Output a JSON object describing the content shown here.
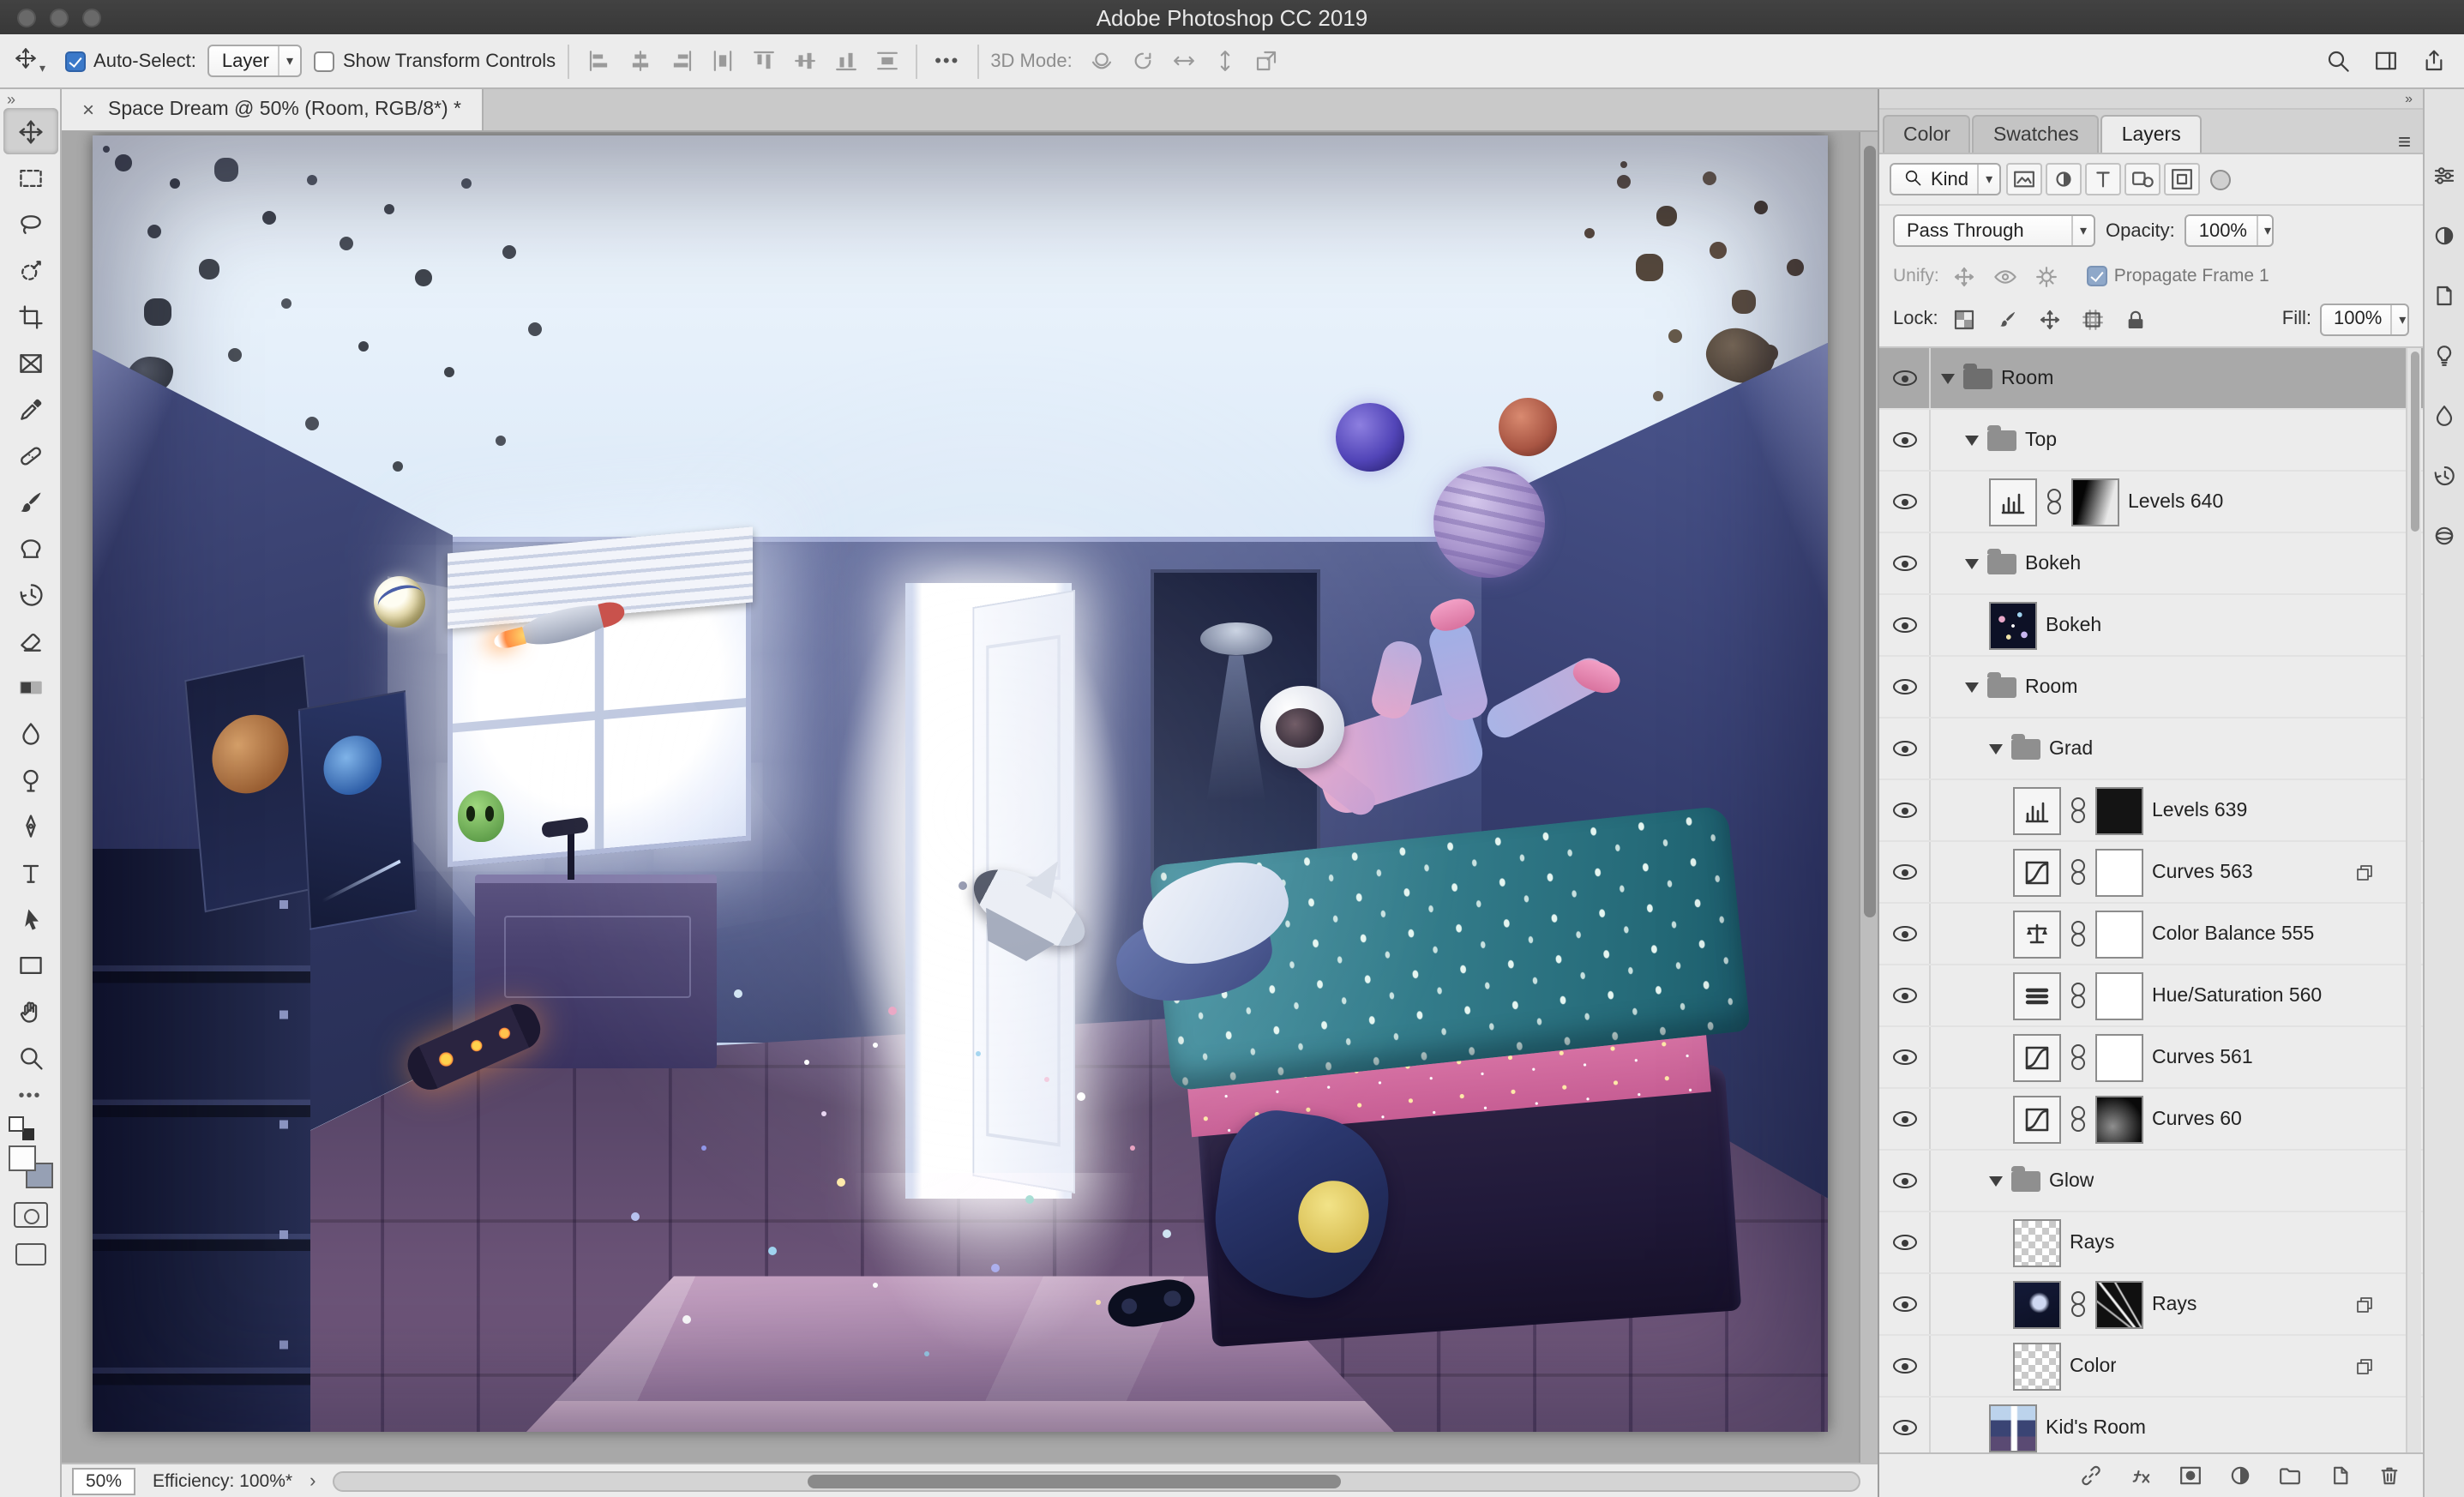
{
  "window": {
    "title": "Adobe Photoshop CC 2019"
  },
  "options_bar": {
    "auto_select": {
      "label": "Auto-Select:",
      "value": "Layer",
      "checked": true
    },
    "show_transform": {
      "label": "Show Transform Controls",
      "checked": false
    },
    "ellipsis": "•••",
    "mode_3d": {
      "label": "3D Mode:"
    },
    "align_icons": [
      "align-left-edges-icon",
      "align-horizontal-centers-icon",
      "align-right-edges-icon",
      "distribute-horizontal-icon",
      "align-top-edges-icon",
      "align-vertical-centers-icon",
      "align-bottom-edges-icon",
      "distribute-vertical-icon"
    ],
    "mode_3d_icons": [
      "3d-orbit-icon",
      "3d-roll-icon",
      "3d-pan-icon",
      "3d-slide-icon",
      "3d-scale-icon"
    ],
    "right_icons": [
      "search-icon",
      "workspace-icon",
      "share-icon"
    ]
  },
  "toolbar": {
    "tools": [
      {
        "id": "move-tool",
        "selected": true
      },
      {
        "id": "marquee-tool"
      },
      {
        "id": "lasso-tool"
      },
      {
        "id": "quick-select-tool"
      },
      {
        "id": "crop-tool"
      },
      {
        "id": "frame-tool"
      },
      {
        "id": "eyedropper-tool"
      },
      {
        "id": "healing-brush-tool"
      },
      {
        "id": "brush-tool"
      },
      {
        "id": "clone-stamp-tool"
      },
      {
        "id": "history-brush-tool"
      },
      {
        "id": "eraser-tool"
      },
      {
        "id": "gradient-tool"
      },
      {
        "id": "blur-tool"
      },
      {
        "id": "dodge-tool"
      },
      {
        "id": "pen-tool"
      },
      {
        "id": "type-tool"
      },
      {
        "id": "path-select-tool"
      },
      {
        "id": "rectangle-tool"
      },
      {
        "id": "hand-tool"
      },
      {
        "id": "zoom-tool"
      }
    ],
    "colors": {
      "foreground": "#fdfdfd",
      "background": "#96a0b4"
    }
  },
  "document_tab": {
    "title": "Space Dream @ 50% (Room, RGB/8*) *",
    "close": "×"
  },
  "canvas": {
    "artwork_colors": {
      "sky": "#dcebf8",
      "wall": "#3a4474",
      "floor": "#5a4a73",
      "door_light": "#ffffff",
      "blanket": "#278092",
      "mattress": "#d96fa0",
      "rug": "#c9a0c0",
      "planet_large": "#a995cd",
      "planet_blue": "#5245b8",
      "planet_red": "#a85543"
    }
  },
  "status_bar": {
    "zoom": "50%",
    "efficiency": "Efficiency: 100%*",
    "chevron": "›"
  },
  "panels": {
    "tabs": [
      {
        "label": "Color",
        "active": false
      },
      {
        "label": "Swatches",
        "active": false
      },
      {
        "label": "Layers",
        "active": true
      }
    ],
    "layers_panel": {
      "kind_filter": {
        "label": "Kind",
        "icons": [
          "pixel-filter-icon",
          "adjustment-filter-icon",
          "type-filter-icon",
          "shape-filter-icon",
          "smart-object-filter-icon"
        ]
      },
      "blend_mode": "Pass Through",
      "opacity": {
        "label": "Opacity:",
        "value": "100%"
      },
      "unify": {
        "label": "Unify:",
        "icons": [
          "unify-position-icon",
          "unify-visibility-icon",
          "unify-style-icon"
        ]
      },
      "propagate": {
        "label": "Propagate Frame 1",
        "checked": true
      },
      "lock": {
        "label": "Lock:",
        "icons": [
          "lock-transparency-icon",
          "lock-paint-icon",
          "lock-position-icon",
          "lock-artboard-icon",
          "lock-all-icon"
        ]
      },
      "fill": {
        "label": "Fill:",
        "value": "100%"
      },
      "rows": [
        {
          "name": "Room",
          "kind": "group",
          "indent": 0,
          "selected": true
        },
        {
          "name": "Top",
          "kind": "group",
          "indent": 1
        },
        {
          "name": "Levels 640",
          "kind": "adjustment",
          "icon": "levels",
          "mask": "gradient",
          "indent": 2
        },
        {
          "name": "Bokeh",
          "kind": "group",
          "indent": 1
        },
        {
          "name": "Bokeh",
          "kind": "layer",
          "thumb": "bokeh",
          "indent": 2
        },
        {
          "name": "Room",
          "kind": "group",
          "indent": 1
        },
        {
          "name": "Grad",
          "kind": "group",
          "indent": 2
        },
        {
          "name": "Levels 639",
          "kind": "adjustment",
          "icon": "levels",
          "mask": "black",
          "indent": 3
        },
        {
          "name": "Curves 563",
          "kind": "adjustment",
          "icon": "curves",
          "mask": "white",
          "indent": 3,
          "badge": true
        },
        {
          "name": "Color Balance 555",
          "kind": "adjustment",
          "icon": "balance",
          "mask": "white",
          "indent": 3
        },
        {
          "name": "Hue/Saturation 560",
          "kind": "adjustment",
          "icon": "huesat",
          "mask": "white",
          "indent": 3
        },
        {
          "name": "Curves 561",
          "kind": "adjustment",
          "icon": "curves",
          "mask": "white",
          "indent": 3
        },
        {
          "name": "Curves 60",
          "kind": "adjustment",
          "icon": "curves",
          "mask": "radial",
          "indent": 3
        },
        {
          "name": "Glow",
          "kind": "group",
          "indent": 2
        },
        {
          "name": "Rays",
          "kind": "layer",
          "thumb": "checker",
          "indent": 3
        },
        {
          "name": "Rays",
          "kind": "layer",
          "thumb": "rays-small",
          "mask": "rays",
          "indent": 3,
          "badge": true
        },
        {
          "name": "Color",
          "kind": "layer",
          "thumb": "checker",
          "indent": 3,
          "badge": true
        },
        {
          "name": "Kid's Room",
          "kind": "layer",
          "thumb": "room",
          "indent": 2
        }
      ],
      "bottom_icons": [
        "link-layers-icon",
        "layer-effects-icon",
        "add-mask-icon",
        "new-adjustment-icon",
        "new-group-icon",
        "new-layer-icon",
        "delete-layer-icon"
      ]
    }
  },
  "dock": {
    "icons": [
      "dock-properties-icon",
      "dock-adjustments-icon",
      "dock-libraries-icon",
      "dock-learn-icon",
      "dock-color-icon",
      "dock-history-icon",
      "dock-3d-icon"
    ]
  },
  "misc": {
    "panel_collapse": "»",
    "toolbar_collapse": "»",
    "panel_menu": "≡",
    "tool_preview_chevron": "▾"
  }
}
